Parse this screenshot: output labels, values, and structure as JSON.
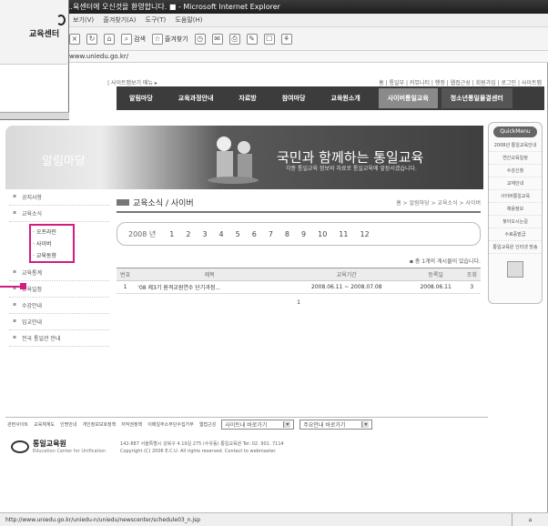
{
  "browser": {
    "title": "…육센터에 오신것을 환영합니다. ■ - Microsoft Internet Explorer",
    "menu": [
      "보기(V)",
      "즐겨찾기(A)",
      "도구(T)",
      "도움말(H)"
    ],
    "toolbar": {
      "search": "검색",
      "favorites": "즐겨찾기"
    },
    "address": "www.uniedu.go.kr/",
    "status_url": "http://www.uniedu.go.kr/uniedu-n/uniedu/newscenter/schedule03_n.jsp"
  },
  "popup": {
    "logo_text": "교육센터"
  },
  "site": {
    "util_left": "| 사이트맵보기 메뉴 ▸",
    "util_right": "홈 | 통일부 | 커뮤니티 | 행정 | 웹접근성 | 회원가입 | 로그인 | 사이트맵",
    "gnb": [
      "알림마당",
      "교육과정안내",
      "자료방",
      "참여마당",
      "교육원소개"
    ],
    "gnb_highlight": "사이버통일교육",
    "gnb_highlight2": "청소년통일물결센터",
    "hero": {
      "title": "알림마당",
      "slogan": "국민과 함께하는 통일교육",
      "sub": "각종 통일교육 정보와 자료로 통일교육에 앞장서겠습니다."
    },
    "quick": {
      "header": "QuickMenu",
      "items": [
        "2008년\n통일교육안내",
        "연간교육일정",
        "수강신청",
        "교재안내",
        "사이버통일교육",
        "채용정보",
        "찾아오시는길",
        "수료증발급",
        "통일교육원\n인터넷 방송"
      ]
    },
    "sidenav": {
      "items": [
        "공지사항",
        "교육소식",
        "교육통계",
        "교육일정",
        "수강안내",
        "입교안내",
        "전국 통일관 안내"
      ],
      "sub": [
        "오프라인",
        "사이버",
        "교육동향"
      ]
    },
    "content": {
      "title": "교육소식 / 사이버",
      "breadcrumb": "홈 > 알림마당 > 교육소식 > 사이버",
      "year_label": "2008 년",
      "months": [
        "1",
        "2",
        "3",
        "4",
        "5",
        "6",
        "7",
        "8",
        "9",
        "10",
        "11",
        "12"
      ],
      "post_count": "▪ 총 1개의 게시물이 있습니다.",
      "columns": [
        "번호",
        "제목",
        "교육기간",
        "등록일",
        "조회"
      ],
      "rows": [
        {
          "no": "1",
          "title": "'08 제3기 원격교원연수 단기과정...",
          "period": "2008.06.11 ~ 2008.07.08",
          "date": "2008.06.11",
          "views": "3"
        }
      ],
      "page": "1"
    },
    "footer": {
      "links": [
        "관련사이트",
        "교육체계도",
        "인명안내",
        "개인정보보호정책",
        "저작권정책",
        "이메일주소무단수집거부",
        "웹접근성",
        "사이트맵"
      ],
      "select1": "사이트내 바로가기",
      "select2": "주요안내 바로가기",
      "logo": "통일교육원",
      "logo_sub": "Education Center for Unification",
      "address": "142-887 서울특별시 강북구 4.19길 275 (수유동) 통일교육원  Tel: 02. 901. 7114",
      "copyright": "Copyright (C) 2006 E.C.U. All rights reserved. Contact to webmaster."
    }
  }
}
